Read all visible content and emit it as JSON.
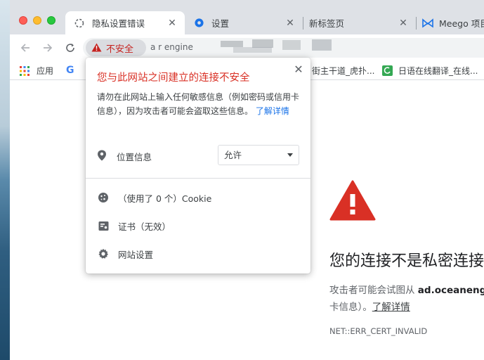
{
  "tabs": [
    {
      "title": "隐私设置错误",
      "active": true
    },
    {
      "title": "设置",
      "active": false
    },
    {
      "title": "新标签页",
      "active": false
    },
    {
      "title": "Meego 项目",
      "active": false
    }
  ],
  "toolbar": {
    "security_chip": "不安全",
    "url_partial": "a  r       engine"
  },
  "bookmarks": {
    "apps": "应用",
    "google_letter": "G",
    "item2": "街主干道_虎扑...",
    "item3": "日语在线翻译_在线..."
  },
  "popup": {
    "title": "您与此网站之间建立的连接不安全",
    "body": "请勿在此网站上输入任何敏感信息（例如密码或信用卡信息），因为攻击者可能会盗取这些信息。",
    "learn_more": "了解详情",
    "location_label": "位置信息",
    "location_value": "允许",
    "cookie_label": "（使用了 0 个）Cookie",
    "cert_label": "证书（无效）",
    "site_settings_label": "网站设置"
  },
  "error_page": {
    "title": "您的连接不是私密连接",
    "desc_prefix": "攻击者可能会试图从",
    "host": "ad.oceanengine",
    "desc_suffix": "卡信息）。",
    "learn_more": "了解详情",
    "code": "NET::ERR_CERT_INVALID"
  },
  "colors": {
    "danger": "#d93025",
    "link": "#1a73e8",
    "warning_icon": "#d93025"
  }
}
